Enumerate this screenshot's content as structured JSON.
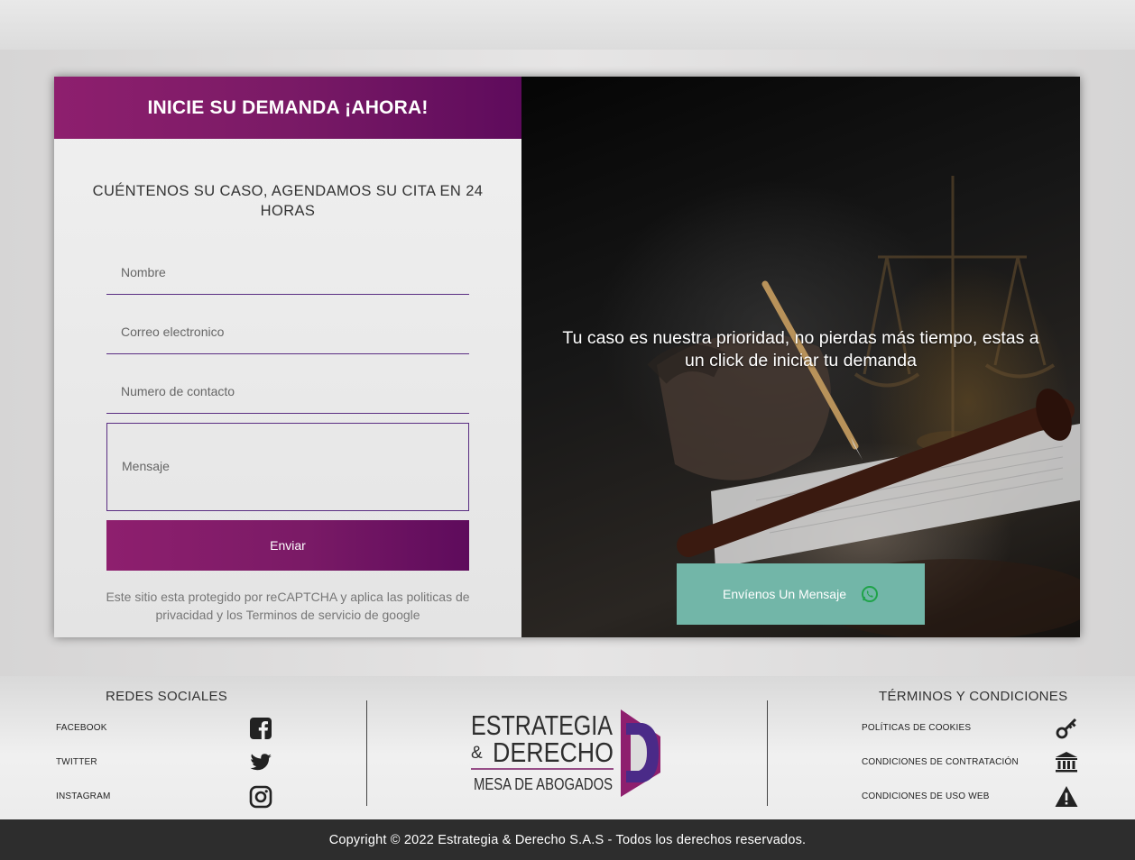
{
  "form": {
    "header_title": "INICIE SU DEMANDA ¡AHORA!",
    "subtitle": "CUÉNTENOS SU CASO, AGENDAMOS SU CITA EN 24 HORAS",
    "name_placeholder": "Nombre",
    "email_placeholder": "Correo electronico",
    "phone_placeholder": "Numero de contacto",
    "message_placeholder": "Mensaje",
    "submit_label": "Enviar",
    "recaptcha_notice": "Este sitio esta protegido por reCAPTCHA y aplica las politicas de privacidad y los Terminos de servicio de google"
  },
  "hero": {
    "text": "Tu caso es nuestra prioridad, no pierdas más tiempo, estas a un click de iniciar tu demanda",
    "whatsapp_label": "Envíenos Un Mensaje",
    "whatsapp_color": "#72b6a8"
  },
  "footer": {
    "social_title": "REDES SOCIALES",
    "social_links": [
      {
        "label": "FACEBOOK",
        "icon": "facebook-icon"
      },
      {
        "label": "TWITTER",
        "icon": "twitter-icon"
      },
      {
        "label": "INSTAGRAM",
        "icon": "instagram-icon"
      }
    ],
    "logo": {
      "line1": "ESTRATEGIA",
      "amp": "&",
      "line2": "DERECHO",
      "line3": "MESA DE ABOGADOS"
    },
    "terms_title": "TÉRMINOS Y CONDICIONES",
    "terms_links": [
      {
        "label": "POLÍTICAS DE COOKIES",
        "icon": "key-icon"
      },
      {
        "label": "CONDICIONES DE CONTRATACIÓN",
        "icon": "bank-icon"
      },
      {
        "label": "CONDICIONES DE USO WEB",
        "icon": "warning-icon"
      }
    ]
  },
  "copyright": "Copyright © 2022 Estrategia & Derecho S.A.S - Todos los derechos reservados.",
  "colors": {
    "brand_purple": "#7a1a66",
    "brand_purple_dark": "#5e0b5c",
    "field_border": "#5a2d82",
    "footer_bar": "#2d2d2d"
  }
}
